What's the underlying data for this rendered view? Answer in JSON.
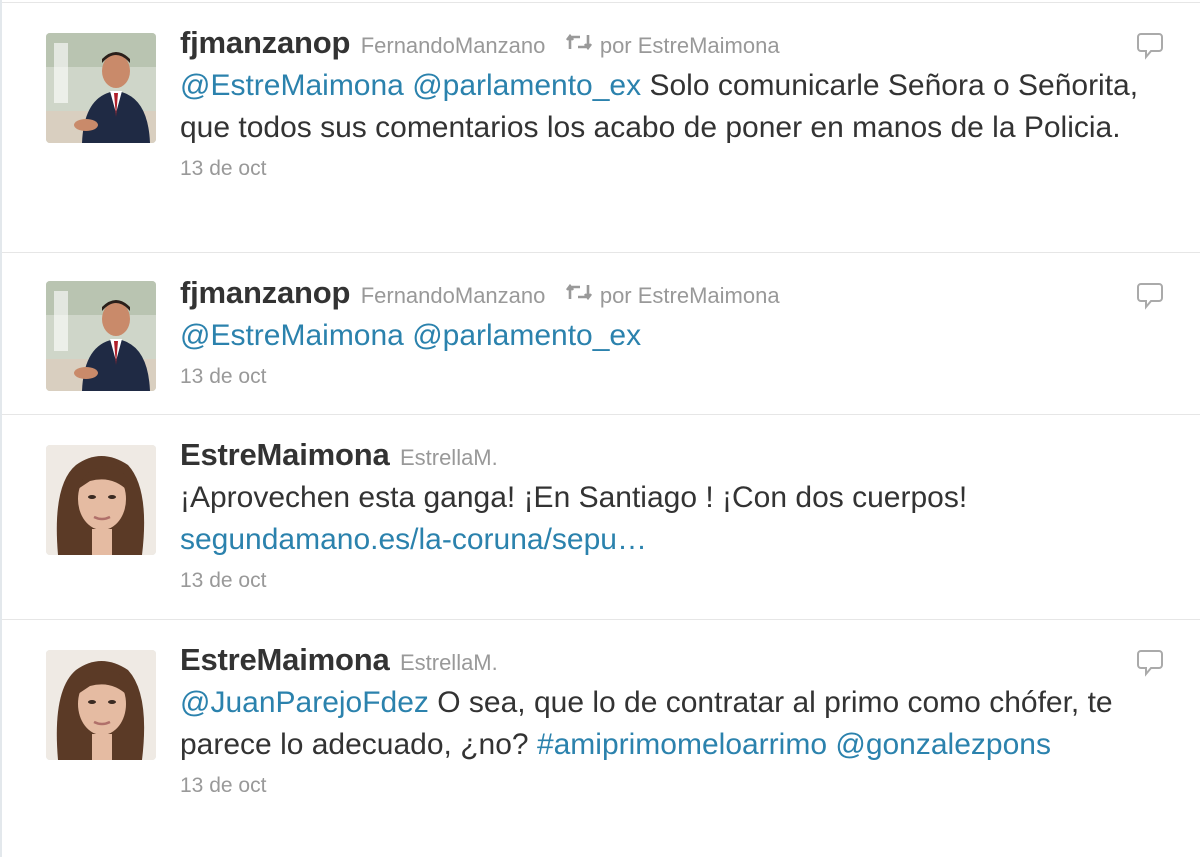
{
  "tweets": [
    {
      "screen_name": "fjmanzanop",
      "full_name": "FernandoManzano",
      "retweeted_by": "por EstreMaimona",
      "text_parts": [
        {
          "type": "mention",
          "text": "@EstreMaimona"
        },
        {
          "type": "text",
          "text": " "
        },
        {
          "type": "mention",
          "text": "@parlamento_ex"
        },
        {
          "type": "text",
          "text": " Solo comunicarle Señora o Señorita, que todos sus comentarios los acabo de poner en manos de la Policia."
        }
      ],
      "time": "13 de oct",
      "avatar": "man-in-suit-avatar"
    },
    {
      "screen_name": "fjmanzanop",
      "full_name": "FernandoManzano",
      "retweeted_by": "por EstreMaimona",
      "text_parts": [
        {
          "type": "mention",
          "text": "@EstreMaimona"
        },
        {
          "type": "text",
          "text": " "
        },
        {
          "type": "mention",
          "text": "@parlamento_ex"
        }
      ],
      "time": "13 de oct",
      "avatar": "man-in-suit-avatar"
    },
    {
      "screen_name": "EstreMaimona",
      "full_name": "EstrellaM.",
      "text_parts": [
        {
          "type": "text",
          "text": "¡Aprovechen esta ganga! ¡En Santiago ! ¡Con dos cuerpos! "
        },
        {
          "type": "link",
          "text": "segundamano.es/la-coruna/sepu…"
        }
      ],
      "time": "13 de oct",
      "avatar": "woman-avatar"
    },
    {
      "screen_name": "EstreMaimona",
      "full_name": "EstrellaM.",
      "text_parts": [
        {
          "type": "mention",
          "text": "@JuanParejoFdez"
        },
        {
          "type": "text",
          "text": " O sea, que lo de contratar al primo como chófer, te parece lo adecuado, ¿no? "
        },
        {
          "type": "hashtag",
          "text": "#amiprimomeloarrimo"
        },
        {
          "type": "text",
          "text": " "
        },
        {
          "type": "mention",
          "text": "@gonzalezpons"
        }
      ],
      "time": "13 de oct",
      "avatar": "woman-avatar"
    }
  ],
  "colors": {
    "link": "#2b82ad",
    "muted": "#999999",
    "text": "#333333",
    "divider": "#e6e6e6"
  }
}
